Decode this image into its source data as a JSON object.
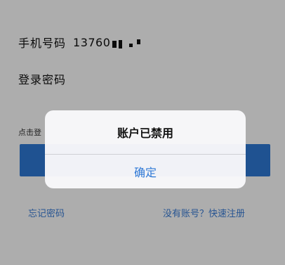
{
  "login": {
    "phone_label": "手机号码",
    "phone_value": "13760",
    "password_label": "登录密码",
    "agreement_text": "点击登",
    "forgot_password": "忘记密码",
    "register": "没有账号？快速注册"
  },
  "dialog": {
    "title": "账户已禁用",
    "confirm": "确定"
  },
  "colors": {
    "accent": "#2f79d6",
    "link": "#3b7ed8"
  }
}
